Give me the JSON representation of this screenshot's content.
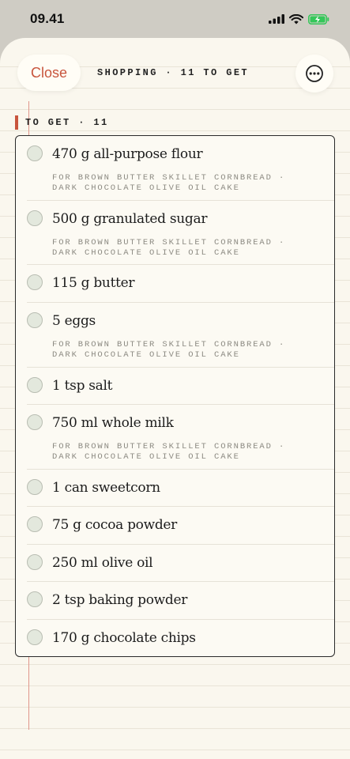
{
  "status": {
    "time": "09.41"
  },
  "header": {
    "close_label": "Close",
    "title": "SHOPPING · 11 TO GET",
    "more_icon": "ellipsis-circle-icon"
  },
  "section": {
    "label": "TO GET · 11"
  },
  "items": [
    {
      "name": "470 g all-purpose flour",
      "for_line1": "FOR BROWN BUTTER SKILLET CORNBREAD ·",
      "for_line2": "DARK CHOCOLATE OLIVE OIL CAKE"
    },
    {
      "name": "500 g granulated sugar",
      "for_line1": "FOR BROWN BUTTER SKILLET CORNBREAD ·",
      "for_line2": "DARK CHOCOLATE OLIVE OIL CAKE"
    },
    {
      "name": "115 g butter"
    },
    {
      "name": "5 eggs",
      "for_line1": "FOR BROWN BUTTER SKILLET CORNBREAD ·",
      "for_line2": "DARK CHOCOLATE OLIVE OIL CAKE"
    },
    {
      "name": "1 tsp salt"
    },
    {
      "name": "750 ml whole milk",
      "for_line1": "FOR BROWN BUTTER SKILLET CORNBREAD ·",
      "for_line2": "DARK CHOCOLATE OLIVE OIL CAKE"
    },
    {
      "name": "1 can sweetcorn"
    },
    {
      "name": "75 g cocoa powder"
    },
    {
      "name": "250 ml olive oil"
    },
    {
      "name": "2 tsp baking powder"
    },
    {
      "name": "170 g chocolate chips"
    }
  ],
  "colors": {
    "accent": "#c8553d",
    "paper": "#faf7ee",
    "ink": "#1c1c1c"
  }
}
